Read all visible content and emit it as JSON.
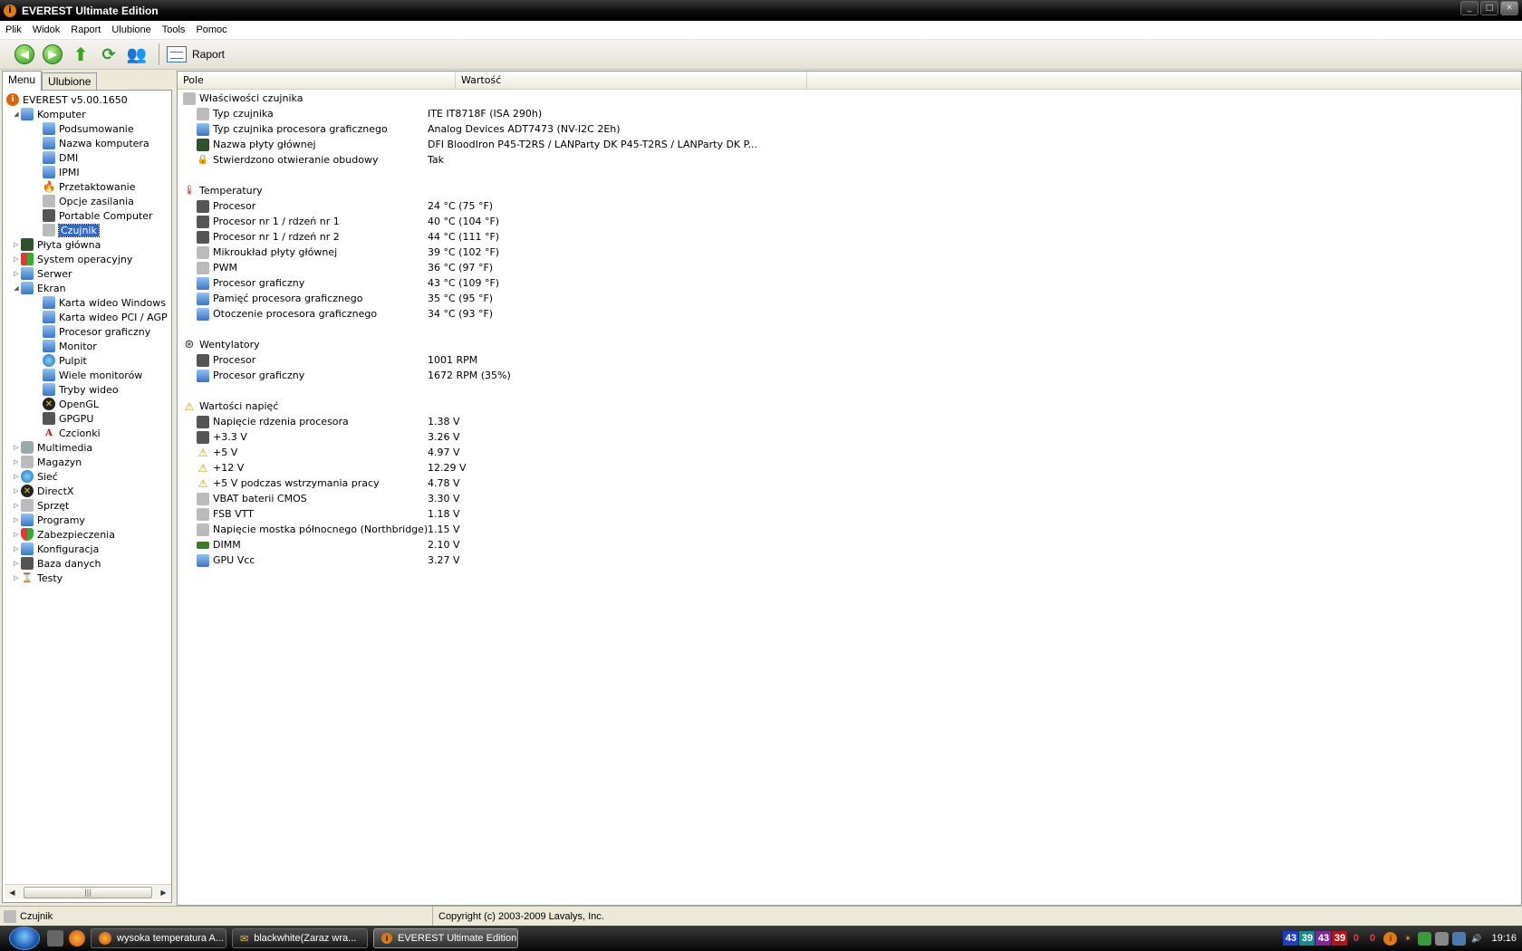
{
  "window": {
    "title": "EVEREST Ultimate Edition"
  },
  "menu": [
    "Plik",
    "Widok",
    "Raport",
    "Ulubione",
    "Tools",
    "Pomoc"
  ],
  "toolbar": {
    "report_label": "Raport"
  },
  "tabs": {
    "menu": "Menu",
    "favorites": "Ulubione"
  },
  "tree": {
    "root": "EVEREST v5.00.1650",
    "computer": "Komputer",
    "computer_children": [
      "Podsumowanie",
      "Nazwa komputera",
      "DMI",
      "IPMI",
      "Przetaktowanie",
      "Opcje zasilania",
      "Portable Computer",
      "Czujnik"
    ],
    "motherboard": "Płyta główna",
    "os": "System operacyjny",
    "server": "Serwer",
    "display": "Ekran",
    "display_children": [
      "Karta wideo Windows",
      "Karta wideo PCI / AGP",
      "Procesor graficzny",
      "Monitor",
      "Pulpit",
      "Wiele monitorów",
      "Tryby wideo",
      "OpenGL",
      "GPGPU",
      "Czcionki"
    ],
    "rest": [
      "Multimedia",
      "Magazyn",
      "Sieć",
      "DirectX",
      "Sprzęt",
      "Programy",
      "Zabezpieczenia",
      "Konfiguracja",
      "Baza danych",
      "Testy"
    ]
  },
  "columns": {
    "field": "Pole",
    "value": "Wartość"
  },
  "sections": {
    "sensor_props": {
      "title": "Właściwości czujnika",
      "rows": [
        {
          "field": "Typ czujnika",
          "value": "ITE IT8718F  (ISA 290h)"
        },
        {
          "field": "Typ czujnika procesora graficznego",
          "value": "Analog Devices ADT7473  (NV-I2C 2Eh)"
        },
        {
          "field": "Nazwa płyty głównej",
          "value": "DFI BloodIron P45-T2RS / LANParty DK P45-T2RS / LANParty DK P..."
        },
        {
          "field": "Stwierdzono otwieranie obudowy",
          "value": "Tak"
        }
      ]
    },
    "temperatures": {
      "title": "Temperatury",
      "rows": [
        {
          "field": "Procesor",
          "value": "24 °C  (75 °F)"
        },
        {
          "field": "Procesor nr 1 / rdzeń nr 1",
          "value": "40 °C  (104 °F)"
        },
        {
          "field": "Procesor nr 1 / rdzeń nr 2",
          "value": "44 °C  (111 °F)"
        },
        {
          "field": "Mikroukład płyty głównej",
          "value": "39 °C  (102 °F)"
        },
        {
          "field": "PWM",
          "value": "36 °C  (97 °F)"
        },
        {
          "field": "Procesor graficzny",
          "value": "43 °C  (109 °F)"
        },
        {
          "field": "Pamięć procesora graficznego",
          "value": "35 °C  (95 °F)"
        },
        {
          "field": "Otoczenie procesora graficznego",
          "value": "34 °C  (93 °F)"
        }
      ]
    },
    "fans": {
      "title": "Wentylatory",
      "rows": [
        {
          "field": "Procesor",
          "value": "1001 RPM"
        },
        {
          "field": "Procesor graficzny",
          "value": "1672 RPM  (35%)"
        }
      ]
    },
    "voltages": {
      "title": "Wartości napięć",
      "rows": [
        {
          "field": "Napięcie rdzenia procesora",
          "value": "1.38 V"
        },
        {
          "field": "+3.3 V",
          "value": "3.26 V"
        },
        {
          "field": "+5 V",
          "value": "4.97 V"
        },
        {
          "field": "+12 V",
          "value": "12.29 V"
        },
        {
          "field": "+5 V podczas wstrzymania pracy",
          "value": "4.78 V"
        },
        {
          "field": "VBAT baterii CMOS",
          "value": "3.30 V"
        },
        {
          "field": "FSB VTT",
          "value": "1.18 V"
        },
        {
          "field": "Napięcie mostka północnego (Northbridge)",
          "value": "1.15 V"
        },
        {
          "field": "DIMM",
          "value": "2.10 V"
        },
        {
          "field": "GPU Vcc",
          "value": "3.27 V"
        }
      ]
    }
  },
  "status": {
    "left": "Czujnik",
    "right": "Copyright (c) 2003-2009 Lavalys, Inc."
  },
  "taskbar": {
    "tasks": [
      "wysoka temperatura A...",
      "blackwhite(Zaraz wra...",
      "EVEREST Ultimate Edition"
    ],
    "tray_numbers": [
      "43",
      "39",
      "43",
      "39",
      "0",
      "0"
    ],
    "clock": "19:16"
  },
  "colors": {
    "selection": "#316ac5",
    "title_bar": "#000000",
    "tray_blue": "#1f3fbf",
    "tray_teal": "#1d8a8a",
    "tray_purple": "#7a2a9a",
    "tray_red": "#b01818"
  }
}
